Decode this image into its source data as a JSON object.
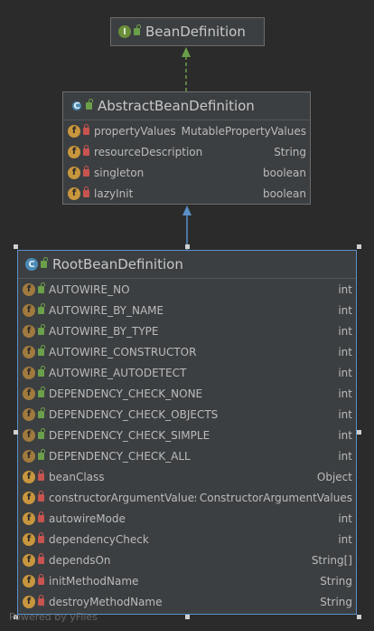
{
  "nodes": {
    "bean_definition": {
      "title": "BeanDefinition",
      "badge": "I"
    },
    "abstract_bean_definition": {
      "title": "AbstractBeanDefinition",
      "badge": "C",
      "fields": [
        {
          "name": "propertyValues",
          "type": "MutablePropertyValues"
        },
        {
          "name": "resourceDescription",
          "type": "String"
        },
        {
          "name": "singleton",
          "type": "boolean"
        },
        {
          "name": "lazyInit",
          "type": "boolean"
        }
      ]
    },
    "root_bean_definition": {
      "title": "RootBeanDefinition",
      "badge": "C",
      "fields": [
        {
          "name": "AUTOWIRE_NO",
          "type": "int"
        },
        {
          "name": "AUTOWIRE_BY_NAME",
          "type": "int"
        },
        {
          "name": "AUTOWIRE_BY_TYPE",
          "type": "int"
        },
        {
          "name": "AUTOWIRE_CONSTRUCTOR",
          "type": "int"
        },
        {
          "name": "AUTOWIRE_AUTODETECT",
          "type": "int"
        },
        {
          "name": "DEPENDENCY_CHECK_NONE",
          "type": "int"
        },
        {
          "name": "DEPENDENCY_CHECK_OBJECTS",
          "type": "int"
        },
        {
          "name": "DEPENDENCY_CHECK_SIMPLE",
          "type": "int"
        },
        {
          "name": "DEPENDENCY_CHECK_ALL",
          "type": "int"
        },
        {
          "name": "beanClass",
          "type": "Object"
        },
        {
          "name": "constructorArgumentValues",
          "type": "ConstructorArgumentValues"
        },
        {
          "name": "autowireMode",
          "type": "int"
        },
        {
          "name": "dependencyCheck",
          "type": "int"
        },
        {
          "name": "dependsOn",
          "type": "String[]"
        },
        {
          "name": "initMethodName",
          "type": "String"
        },
        {
          "name": "destroyMethodName",
          "type": "String"
        }
      ]
    }
  },
  "badge_field": "f",
  "watermark": "Powered by yFiles",
  "colors": {
    "background": "#2b2b2b",
    "node_fill": "#3c3f41",
    "selected_border": "#5a8fc8",
    "realization_edge": "#6a9f4a",
    "inheritance_edge": "#5a8fc8"
  }
}
